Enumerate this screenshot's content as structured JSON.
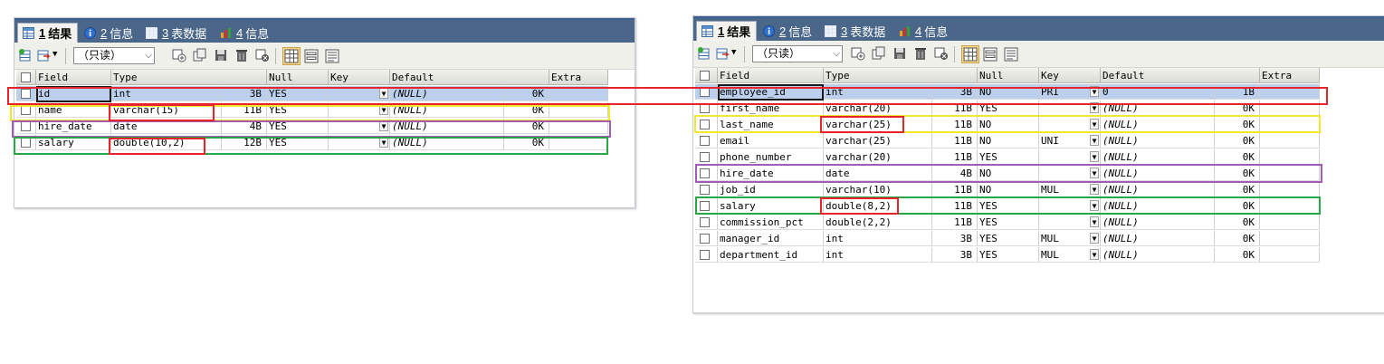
{
  "tabs": [
    {
      "num": "1",
      "label": "结果"
    },
    {
      "num": "2",
      "label": "信息"
    },
    {
      "num": "3",
      "label": "表数据"
    },
    {
      "num": "4",
      "label": "信息"
    }
  ],
  "toolbar": {
    "mode_select": "（只读）"
  },
  "columns": [
    "Field",
    "Type",
    "Null",
    "Key",
    "Default",
    "Extra"
  ],
  "colors": {
    "red": "#e8242b",
    "yellow": "#f2e82a",
    "purple": "#a45ab8",
    "green": "#27a844",
    "selected_row": "#bcd0ee",
    "tabbar": "#4a6688"
  },
  "left_table": {
    "rows": [
      {
        "field": "id",
        "type": "int",
        "size": "3B",
        "null": "YES",
        "key": "",
        "default": "(NULL)",
        "dsize": "0K",
        "extra": ""
      },
      {
        "field": "name",
        "type": "varchar(15)",
        "size": "11B",
        "null": "YES",
        "key": "",
        "default": "(NULL)",
        "dsize": "0K",
        "extra": ""
      },
      {
        "field": "hire_date",
        "type": "date",
        "size": "4B",
        "null": "YES",
        "key": "",
        "default": "(NULL)",
        "dsize": "0K",
        "extra": ""
      },
      {
        "field": "salary",
        "type": "double(10,2)",
        "size": "12B",
        "null": "YES",
        "key": "",
        "default": "(NULL)",
        "dsize": "0K",
        "extra": ""
      }
    ]
  },
  "right_table": {
    "rows": [
      {
        "field": "employee_id",
        "type": "int",
        "size": "3B",
        "null": "NO",
        "key": "PRI",
        "default": "0",
        "dsize": "1B",
        "extra": ""
      },
      {
        "field": "first_name",
        "type": "varchar(20)",
        "size": "11B",
        "null": "YES",
        "key": "",
        "default": "(NULL)",
        "dsize": "0K",
        "extra": ""
      },
      {
        "field": "last_name",
        "type": "varchar(25)",
        "size": "11B",
        "null": "NO",
        "key": "",
        "default": "(NULL)",
        "dsize": "0K",
        "extra": ""
      },
      {
        "field": "email",
        "type": "varchar(25)",
        "size": "11B",
        "null": "NO",
        "key": "UNI",
        "default": "(NULL)",
        "dsize": "0K",
        "extra": ""
      },
      {
        "field": "phone_number",
        "type": "varchar(20)",
        "size": "11B",
        "null": "YES",
        "key": "",
        "default": "(NULL)",
        "dsize": "0K",
        "extra": ""
      },
      {
        "field": "hire_date",
        "type": "date",
        "size": "4B",
        "null": "NO",
        "key": "",
        "default": "(NULL)",
        "dsize": "0K",
        "extra": ""
      },
      {
        "field": "job_id",
        "type": "varchar(10)",
        "size": "11B",
        "null": "NO",
        "key": "MUL",
        "default": "(NULL)",
        "dsize": "0K",
        "extra": ""
      },
      {
        "field": "salary",
        "type": "double(8,2)",
        "size": "11B",
        "null": "YES",
        "key": "",
        "default": "(NULL)",
        "dsize": "0K",
        "extra": ""
      },
      {
        "field": "commission_pct",
        "type": "double(2,2)",
        "size": "11B",
        "null": "YES",
        "key": "",
        "default": "(NULL)",
        "dsize": "0K",
        "extra": ""
      },
      {
        "field": "manager_id",
        "type": "int",
        "size": "3B",
        "null": "YES",
        "key": "MUL",
        "default": "(NULL)",
        "dsize": "0K",
        "extra": ""
      },
      {
        "field": "department_id",
        "type": "int",
        "size": "3B",
        "null": "YES",
        "key": "MUL",
        "default": "(NULL)",
        "dsize": "0K",
        "extra": ""
      }
    ]
  }
}
